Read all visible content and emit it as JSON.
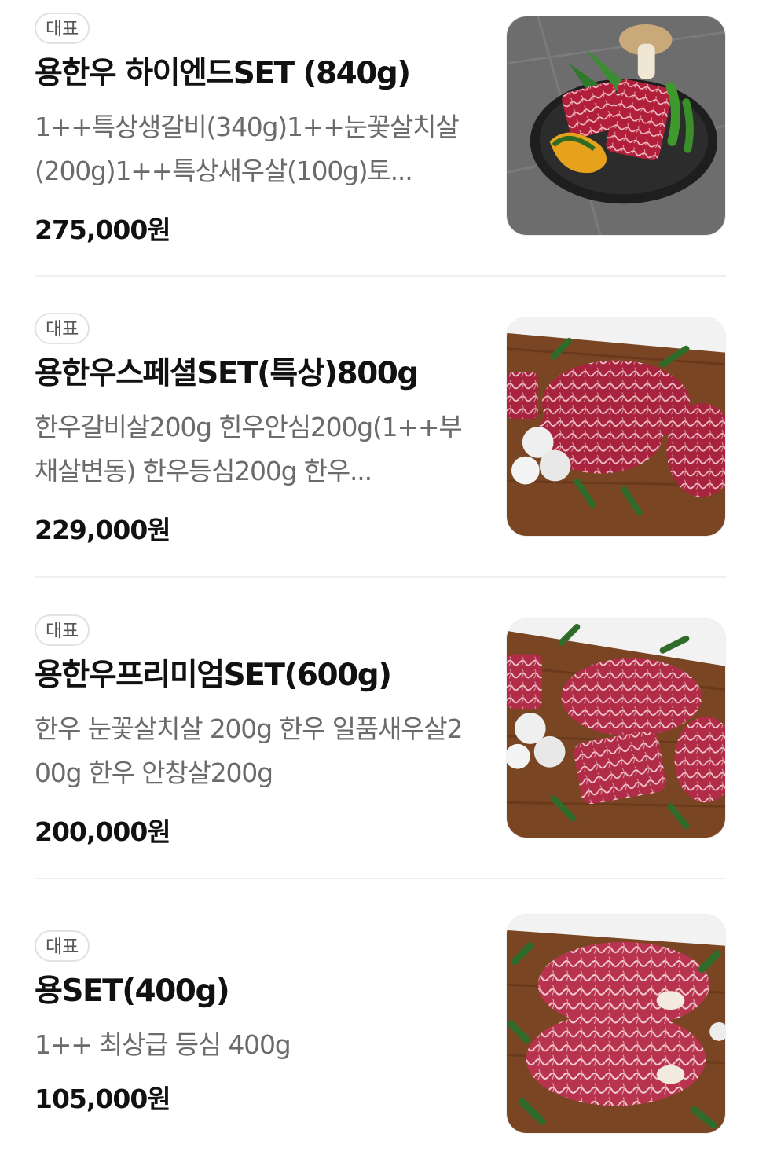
{
  "menu": {
    "items": [
      {
        "badge": "대표",
        "name": "용한우 하이엔드SET (840g)",
        "description": "1++특상생갈비(340g)1++눈꽃살치살(200g)1++특상새우살(100g)토...",
        "price": "275,000원",
        "image": "black-plate-marbled-beef-photo"
      },
      {
        "badge": "대표",
        "name": "용한우스페셜SET(특상)800g",
        "description": "한우갈비살200g 힌우안심200g(1++부채살변동) 한우등심200g 한우...",
        "price": "229,000원",
        "image": "wood-board-beef-mushroom-photo"
      },
      {
        "badge": "대표",
        "name": "용한우프리미엄SET(600g)",
        "description": "한우 눈꽃살치살 200g 한우 일품새우살200g 한우 안창살200g",
        "price": "200,000원",
        "image": "wood-board-beef-mushroom-photo"
      },
      {
        "badge": "대표",
        "name": "용SET(400g)",
        "description": "1++ 최상급 등심 400g",
        "price": "105,000원",
        "image": "wood-board-ribeye-photo"
      }
    ]
  }
}
